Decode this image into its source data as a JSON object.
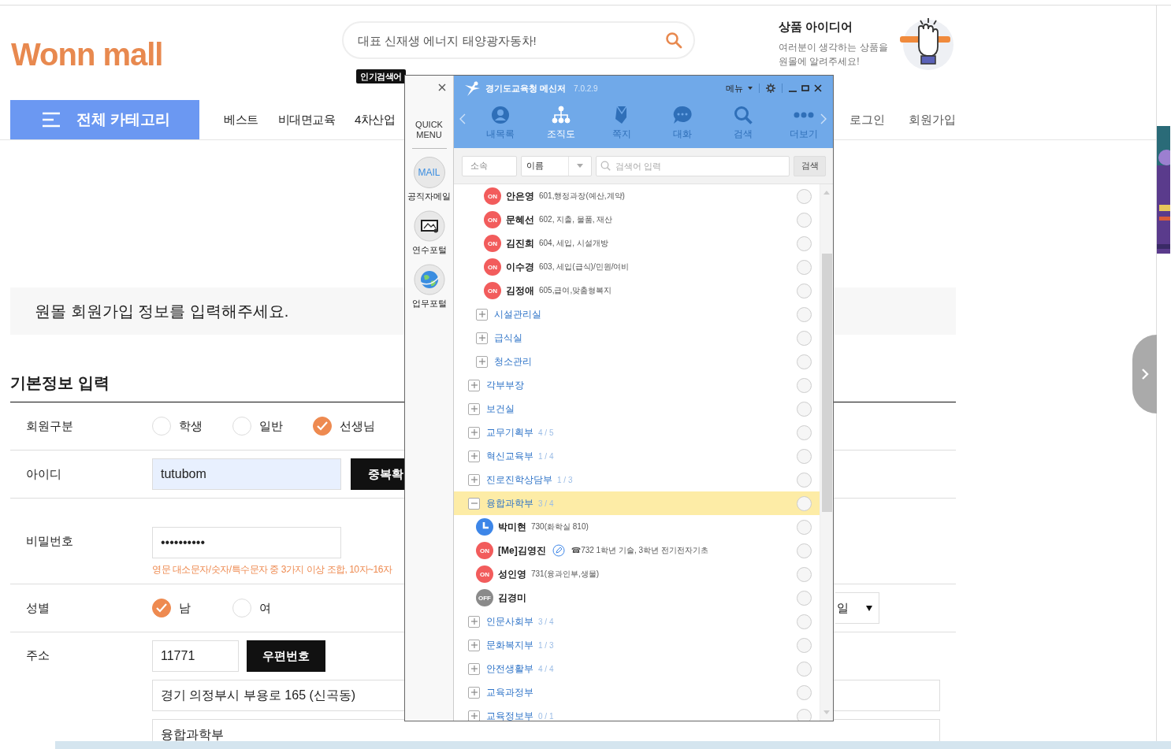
{
  "header": {
    "logo": "Wonn mall",
    "search": {
      "placeholder": "대표 신재생 에너지 태양광자동차!"
    },
    "popular_tag": "인기검색어",
    "promo": {
      "title": "상품 아이디어",
      "text": "여러분이 생각하는 상품을 원몰에 알려주세요!"
    }
  },
  "nav": {
    "category_button": "전체 카테고리",
    "items": [
      "베스트",
      "비대면교육",
      "4차산업"
    ],
    "account": [
      "로그인",
      "회원가입"
    ]
  },
  "banner": "원몰 회원가입 정보를 입력해주세요.",
  "form": {
    "title": "기본정보 입력",
    "member_type": {
      "label": "회원구분",
      "options": [
        {
          "label": "학생",
          "selected": false
        },
        {
          "label": "일반",
          "selected": false
        },
        {
          "label": "선생님",
          "selected": true
        }
      ]
    },
    "id": {
      "label": "아이디",
      "value": "tutubom",
      "button": "중복확"
    },
    "password": {
      "label": "비밀번호",
      "value": "••••••••••",
      "hint": "영문 대소문자/숫자/특수문자 중 3가지 이상 조합, 10자~16자"
    },
    "gender": {
      "label": "성별",
      "options": [
        {
          "label": "남",
          "selected": true
        },
        {
          "label": "여",
          "selected": false
        }
      ],
      "birth_select": "일"
    },
    "address": {
      "label": "주소",
      "zip": "11771",
      "zip_button": "우편번호",
      "line1": "경기 의정부시 부용로 165 (신곡동)",
      "line2": "융합과학부"
    }
  },
  "messenger": {
    "quick_menu": {
      "title": "QUICK MENU",
      "items": [
        {
          "kind": "mail",
          "icon_text": "MAIL",
          "label": "공직자메일"
        },
        {
          "kind": "training",
          "label": "연수포털"
        },
        {
          "kind": "globe",
          "label": "업무포털"
        }
      ]
    },
    "title": "경기도교육청 메신저",
    "version": "7.0.2.9",
    "menu": "메뉴",
    "tabs": [
      {
        "kind": "contacts",
        "label": "내목록",
        "selected": false
      },
      {
        "kind": "org",
        "label": "조직도",
        "selected": true
      },
      {
        "kind": "note",
        "label": "쪽지",
        "selected": false
      },
      {
        "kind": "chat",
        "label": "대화",
        "selected": false
      },
      {
        "kind": "search",
        "label": "검색",
        "selected": false
      },
      {
        "kind": "more",
        "label": "더보기",
        "selected": false
      }
    ],
    "search": {
      "scope": "소속",
      "field": "이름",
      "placeholder": "검색어 입력",
      "button": "검색"
    },
    "tree": [
      {
        "children": [
          {
            "children": [
              {
                "kind": "person",
                "name": "안은영",
                "note": "601,행정과장(예산,계약)",
                "color": "#f25c5c",
                "badge": "ON",
                "editable": false,
                "selected": false,
                "checked": false
              },
              {
                "kind": "person",
                "name": "문혜선",
                "note": "602, 지출, 물품, 재산",
                "color": "#f25c5c",
                "badge": "ON",
                "editable": false,
                "selected": false,
                "checked": false
              },
              {
                "kind": "person",
                "name": "김진희",
                "note": "604, 세입, 시설개방",
                "color": "#f25c5c",
                "badge": "ON",
                "editable": false,
                "selected": false,
                "checked": false
              },
              {
                "kind": "person",
                "name": "이수경",
                "note": "603, 세입(급식)/민원/여비",
                "color": "#f25c5c",
                "badge": "ON",
                "editable": false,
                "selected": false,
                "checked": false
              },
              {
                "kind": "person",
                "name": "김정애",
                "note": "605,급여,맞춤형복지",
                "color": "#f25c5c",
                "badge": "ON",
                "editable": false,
                "selected": false,
                "checked": false
              }
            ]
          },
          {
            "kind": "group",
            "label": "시설관리실",
            "expanded": false,
            "selected": false,
            "checked": false
          },
          {
            "kind": "group",
            "label": "급식실",
            "expanded": false,
            "selected": false,
            "checked": false
          },
          {
            "kind": "group",
            "label": "청소관리",
            "expanded": false,
            "selected": false,
            "checked": false
          }
        ]
      },
      {
        "kind": "group",
        "label": "각부부장",
        "expanded": false,
        "selected": false,
        "checked": false
      },
      {
        "kind": "group",
        "label": "보건실",
        "expanded": false,
        "selected": false,
        "checked": false
      },
      {
        "kind": "group",
        "label": "교무기획부",
        "count": "4 / 5",
        "expanded": false,
        "selected": false,
        "checked": false
      },
      {
        "kind": "group",
        "label": "혁신교육부",
        "count": "1 / 4",
        "expanded": false,
        "selected": false,
        "checked": false
      },
      {
        "kind": "group",
        "label": "진로진학상담부",
        "count": "1 / 3",
        "expanded": false,
        "selected": false,
        "checked": false
      },
      {
        "kind": "group",
        "label": "융합과학부",
        "count": "3 / 4",
        "expanded": true,
        "selected": true,
        "checked": false,
        "children": [
          {
            "kind": "person",
            "name": "박미현",
            "note": "730(화학실 810)",
            "color": "#3d86e8",
            "editable": false,
            "selected": false,
            "checked": false
          },
          {
            "kind": "person",
            "name": "[Me]김영진",
            "note": "☎732 1학년 기술, 3학년 전기전자기초",
            "color": "#f25c5c",
            "badge": "ON",
            "editable": true,
            "selected": false,
            "checked": false
          },
          {
            "kind": "person",
            "name": "성인영",
            "note": "731(융과인부,생물)",
            "color": "#f25c5c",
            "badge": "ON",
            "editable": false,
            "selected": false,
            "checked": false
          },
          {
            "kind": "person",
            "name": "김경미",
            "color": "#8a8a8a",
            "badge": "OFF",
            "editable": false,
            "selected": false,
            "checked": false
          }
        ]
      },
      {
        "kind": "group",
        "label": "인문사회부",
        "count": "3 / 4",
        "expanded": false,
        "selected": false,
        "checked": false
      },
      {
        "kind": "group",
        "label": "문화복지부",
        "count": "1 / 3",
        "expanded": false,
        "selected": false,
        "checked": false
      },
      {
        "kind": "group",
        "label": "안전생활부",
        "count": "4 / 4",
        "expanded": false,
        "selected": false,
        "checked": false
      },
      {
        "kind": "group",
        "label": "교육과정부",
        "expanded": false,
        "selected": false,
        "checked": false
      },
      {
        "kind": "group",
        "label": "교육정보부",
        "count": "0 / 1",
        "expanded": false,
        "selected": false,
        "checked": false
      }
    ]
  }
}
